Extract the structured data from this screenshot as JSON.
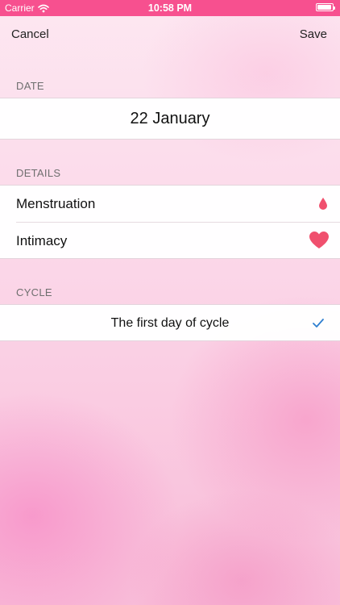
{
  "status_bar": {
    "carrier": "Carrier",
    "time": "10:58 PM",
    "wifi_icon": "wifi-icon",
    "battery_icon": "battery-icon"
  },
  "navbar": {
    "cancel_label": "Cancel",
    "save_label": "Save"
  },
  "sections": {
    "date": {
      "header": "DATE",
      "value": "22 January"
    },
    "details": {
      "header": "DETAILS",
      "items": [
        {
          "label": "Menstruation",
          "icon": "blood-drop-icon",
          "icon_color": "#f0506e"
        },
        {
          "label": "Intimacy",
          "icon": "heart-icon",
          "icon_color": "#f0506e"
        }
      ]
    },
    "cycle": {
      "header": "CYCLE",
      "item": {
        "label": "The first day of cycle",
        "icon": "checkmark-icon",
        "icon_color": "#2f7fd0",
        "selected": true
      }
    }
  },
  "colors": {
    "status_bar": "#f7508f",
    "accent": "#f0506e",
    "check": "#2f7fd0"
  }
}
